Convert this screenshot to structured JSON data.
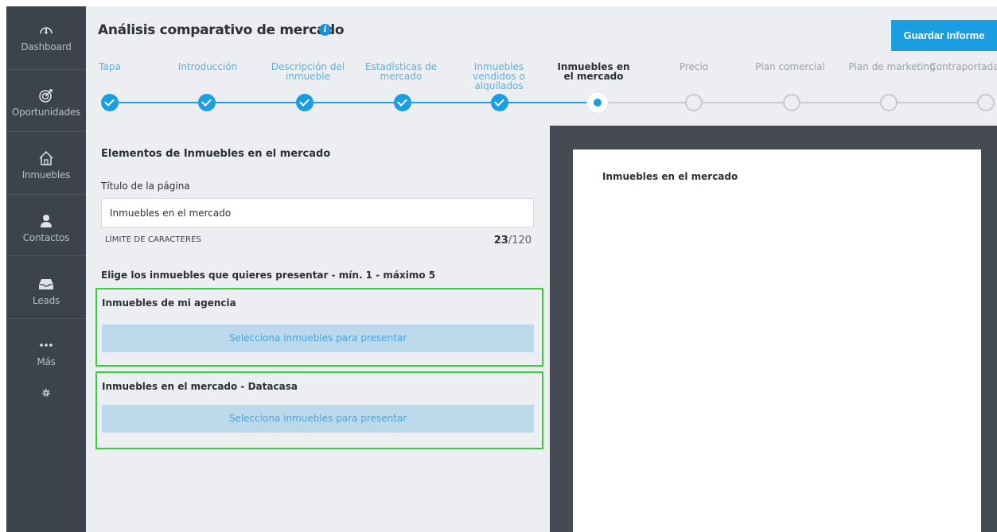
{
  "sidebar": {
    "items": [
      {
        "label": "Dashboard",
        "icon": "gauge-icon"
      },
      {
        "label": "Oportunidades",
        "icon": "target-icon"
      },
      {
        "label": "Inmuebles",
        "icon": "house-icon"
      },
      {
        "label": "Contactos",
        "icon": "person-icon"
      },
      {
        "label": "Leads",
        "icon": "inbox-icon"
      },
      {
        "label": "Más",
        "icon": "more-icon"
      }
    ],
    "settings_icon": "gear-icon"
  },
  "header": {
    "title": "Análisis comparativo de mercado",
    "info_icon": "info-icon",
    "save_label": "Guardar Informe"
  },
  "stepper": {
    "steps": [
      {
        "label": "Tapa",
        "state": "done"
      },
      {
        "label": "Introducción",
        "state": "done"
      },
      {
        "label": "Descripción del inmueble",
        "state": "done"
      },
      {
        "label": "Estadísticas de mercado",
        "state": "done"
      },
      {
        "label": "Inmuebles vendidos o alquilados",
        "state": "done"
      },
      {
        "label": "Inmuebles en el mercado",
        "state": "active"
      },
      {
        "label": "Precio",
        "state": "future"
      },
      {
        "label": "Plan comercial",
        "state": "future"
      },
      {
        "label": "Plan de marketing",
        "state": "future"
      },
      {
        "label": "Contraportada",
        "state": "future"
      }
    ]
  },
  "editor": {
    "section_title": "Elementos de Inmuebles en el mercado",
    "page_title_label": "Título de la página",
    "page_title_value": "Inmuebles en el mercado",
    "char_limit_label": "LÍMITE DE CARACTERES",
    "char_count": "23",
    "char_max": "/120",
    "choose_label": "Elige los inmuebles que quieres presentar - mín. 1 - máximo 5",
    "agency_box": {
      "title": "Inmuebles de mi agencia",
      "button": "Selecciona inmuebles para presentar"
    },
    "market_box": {
      "title": "Inmuebles en el mercado - Datacasa",
      "button": "Selecciona inmuebles para presentar"
    }
  },
  "preview": {
    "heading": "Inmuebles en el mercado"
  },
  "colors": {
    "accent": "#1b9de2",
    "sidebar": "#3d434c",
    "highlight_border": "#35d13a",
    "select_button_bg": "#bcd9ec",
    "preview_bg": "#464b53"
  }
}
